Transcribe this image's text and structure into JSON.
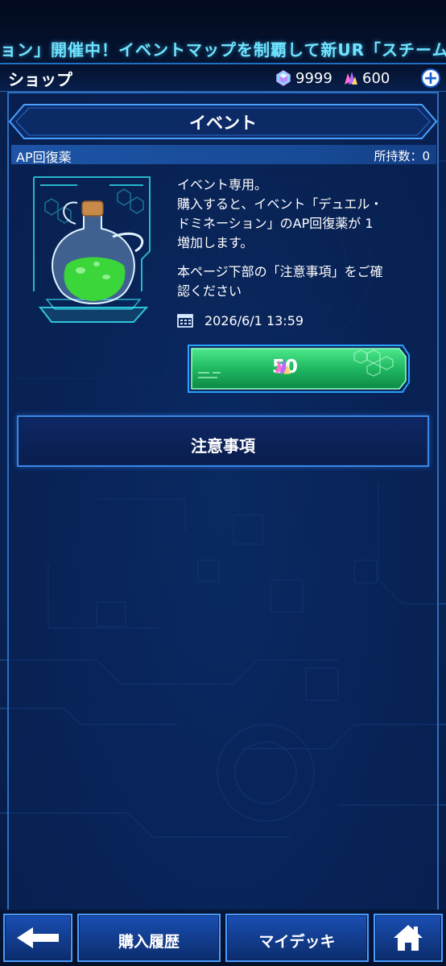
{
  "ticker": {
    "text": "ョン」開催中！イベントマップを制覇して新UR「スチーム・"
  },
  "header": {
    "title": "ショップ",
    "gems": "9999",
    "crystals": "600"
  },
  "section": {
    "title": "イベント"
  },
  "item": {
    "name": "AP回復薬",
    "owned": "所持数：0",
    "desc_lines": [
      "イベント専用。",
      "購入すると、イベント「デュエル・",
      "ドミネーション」のAP回復薬が 1",
      "増加します。"
    ],
    "note_lines": [
      "本ページ下部の「注意事項」をご確",
      "認ください"
    ],
    "date": "2026/6/1 13:59",
    "price": "50"
  },
  "notice": {
    "label": "注意事項"
  },
  "nav": {
    "history": "購入履歴",
    "deck": "マイデッキ"
  },
  "icons": {
    "back": "back-arrow-icon",
    "home": "home-icon",
    "gem": "gem-icon",
    "crystal": "crystal-icon",
    "calendar": "calendar-icon",
    "potion": "potion-icon",
    "plus": "plus-icon"
  },
  "colors": {
    "accent": "#3a86e6",
    "ticker": "#6fe4ff",
    "buy": "#2fd36a"
  }
}
